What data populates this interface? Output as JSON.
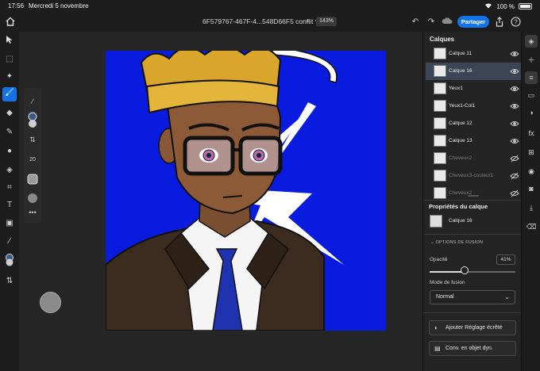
{
  "status": {
    "time": "17:56",
    "date": "Mercredi 5 novembre",
    "battery": "100 %"
  },
  "topbar": {
    "doc_title": "6F579767-467F-4...548D66F5 conflit *",
    "zoom": "143%",
    "share_label": "Partager"
  },
  "layers_panel": {
    "title": "Calques",
    "layers": [
      {
        "name": "Calque 11",
        "visible": true,
        "selected": false,
        "dim": false
      },
      {
        "name": "Calque 16",
        "visible": true,
        "selected": true,
        "dim": false
      },
      {
        "name": "Yeux1",
        "visible": true,
        "selected": false,
        "dim": false
      },
      {
        "name": "Yeux1-Col1",
        "visible": true,
        "selected": false,
        "dim": false
      },
      {
        "name": "Calque 12",
        "visible": true,
        "selected": false,
        "dim": false
      },
      {
        "name": "Calque 13",
        "visible": true,
        "selected": false,
        "dim": false
      },
      {
        "name": "Cheveux2",
        "visible": false,
        "selected": false,
        "dim": true
      },
      {
        "name": "Cheveux3-couleur1",
        "visible": false,
        "selected": false,
        "dim": true
      },
      {
        "name": "Cheveux2",
        "visible": false,
        "selected": false,
        "dim": true
      }
    ]
  },
  "properties": {
    "title": "Propriétés du calque",
    "layer_name": "Calque 16",
    "fusion_header": "OPTIONS DE FUSION",
    "opacity_label": "Opacité",
    "opacity_value": "41%",
    "opacity_fraction": 0.41,
    "mode_label": "Mode de fusion",
    "mode_value": "Normal",
    "btn_adjust": "Ajouter Réglage écrêté",
    "btn_convert": "Conv. en objet dyn."
  },
  "brush_panel": {
    "size": "20"
  },
  "colors": {
    "accent": "#1473e6",
    "canvas_bg": "#0a1be0"
  }
}
